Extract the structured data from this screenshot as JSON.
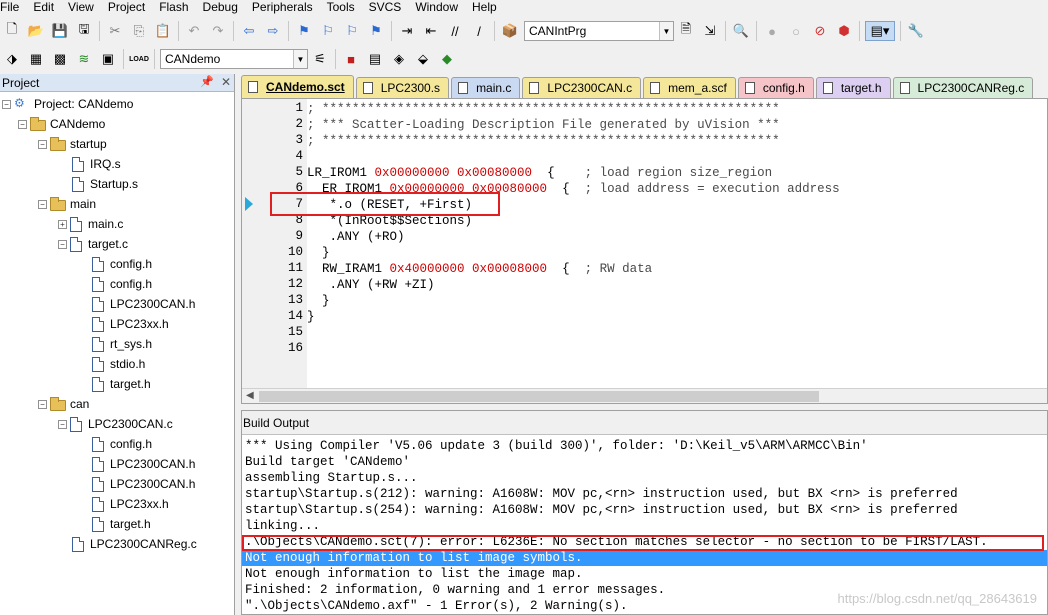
{
  "menu": [
    "File",
    "Edit",
    "View",
    "Project",
    "Flash",
    "Debug",
    "Peripherals",
    "Tools",
    "SVCS",
    "Window",
    "Help"
  ],
  "toolbar": {
    "target_combo": "CANIntPrg",
    "project_combo": "CANdemo",
    "load_label": "LOAD"
  },
  "project": {
    "title": "Project",
    "root": "Project: CANdemo",
    "target": "CANdemo",
    "groups": [
      {
        "name": "startup",
        "files": [
          "IRQ.s",
          "Startup.s"
        ]
      },
      {
        "name": "main",
        "files": [
          "main.c",
          "target.c"
        ],
        "target_children": [
          "config.h",
          "config.h",
          "LPC2300CAN.h",
          "LPC23xx.h",
          "rt_sys.h",
          "stdio.h",
          "target.h"
        ]
      },
      {
        "name": "can",
        "files": [
          "LPC2300CAN.c",
          "LPC2300CANReg.c"
        ],
        "can_children": [
          "config.h",
          "LPC2300CAN.h",
          "LPC2300CAN.h",
          "LPC23xx.h",
          "target.h"
        ]
      }
    ]
  },
  "tabs": [
    {
      "label": "CANdemo.sct",
      "active": true,
      "color": "#f4e79a"
    },
    {
      "label": "LPC2300.s",
      "active": false,
      "color": "#f4e79a"
    },
    {
      "label": "main.c",
      "active": false,
      "color": "#c9d9f2"
    },
    {
      "label": "LPC2300CAN.c",
      "active": false,
      "color": "#f4e79a"
    },
    {
      "label": "mem_a.scf",
      "active": false,
      "color": "#f4e79a"
    },
    {
      "label": "config.h",
      "active": false,
      "color": "#f4c4c8"
    },
    {
      "label": "target.h",
      "active": false,
      "color": "#dccff2"
    },
    {
      "label": "LPC2300CANReg.c",
      "active": false,
      "color": "#d6ecd8"
    }
  ],
  "editor": {
    "line_numbers": [
      "1",
      "2",
      "3",
      "4",
      "5",
      "6",
      "7",
      "8",
      "9",
      "10",
      "11",
      "12",
      "13",
      "14",
      "15",
      "16"
    ],
    "lines": [
      [
        {
          "t": "; *************************************************************",
          "c": "cmt"
        }
      ],
      [
        {
          "t": "; *** Scatter-Loading Description File generated by uVision ***",
          "c": "cmt"
        }
      ],
      [
        {
          "t": "; *************************************************************",
          "c": "cmt"
        }
      ],
      [],
      [
        {
          "t": "LR_IROM1 "
        },
        {
          "t": "0x00000000",
          "c": "hex"
        },
        {
          "t": " "
        },
        {
          "t": "0x00080000",
          "c": "hex"
        },
        {
          "t": "  {    "
        },
        {
          "t": "; load region size_region",
          "c": "cmt"
        }
      ],
      [
        {
          "t": "  ER_IROM1 "
        },
        {
          "t": "0x00000000",
          "c": "hex"
        },
        {
          "t": " "
        },
        {
          "t": "0x00080000",
          "c": "hex"
        },
        {
          "t": "  {  "
        },
        {
          "t": "; load address = execution address",
          "c": "cmt"
        }
      ],
      [
        {
          "t": "   *.o (RESET, +First)"
        }
      ],
      [
        {
          "t": "   *(InRoot$$Sections)"
        }
      ],
      [
        {
          "t": "   .ANY (+RO)"
        }
      ],
      [
        {
          "t": "  }"
        }
      ],
      [
        {
          "t": "  RW_IRAM1 "
        },
        {
          "t": "0x40000000",
          "c": "hex"
        },
        {
          "t": " "
        },
        {
          "t": "0x00008000",
          "c": "hex"
        },
        {
          "t": "  {  "
        },
        {
          "t": "; RW data",
          "c": "cmt"
        }
      ],
      [
        {
          "t": "   .ANY (+RW +ZI)"
        }
      ],
      [
        {
          "t": "  }"
        }
      ],
      [
        {
          "t": "}"
        }
      ],
      [],
      []
    ]
  },
  "build": {
    "title": "Build Output",
    "lines": [
      "*** Using Compiler 'V5.06 update 3 (build 300)', folder: 'D:\\Keil_v5\\ARM\\ARMCC\\Bin'",
      "Build target 'CANdemo'",
      "assembling Startup.s...",
      "startup\\Startup.s(212): warning: A1608W: MOV pc,<rn> instruction used, but BX <rn> is preferred",
      "startup\\Startup.s(254): warning: A1608W: MOV pc,<rn> instruction used, but BX <rn> is preferred",
      "linking...",
      ".\\Objects\\CANdemo.sct(7): error: L6236E: No section matches selector - no section to be FIRST/LAST.",
      "Not enough information to list image symbols.",
      "Not enough information to list the image map.",
      "Finished: 2 information, 0 warning and 1 error messages.",
      "\".\\Objects\\CANdemo.axf\" - 1 Error(s), 2 Warning(s)."
    ]
  },
  "watermark": "https://blog.csdn.net/qq_28643619",
  "colors": {
    "highlight_box": "#e02020",
    "selection": "#3399ff",
    "hex": "#d00000"
  }
}
